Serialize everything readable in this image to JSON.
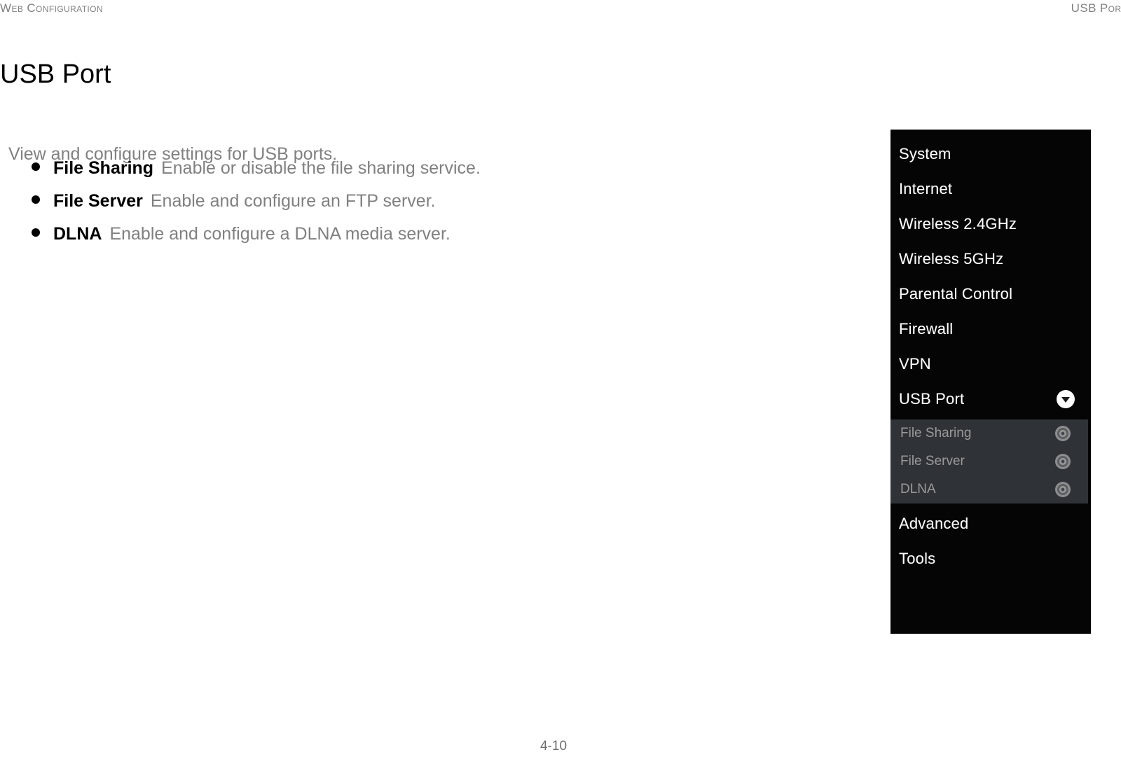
{
  "header": {
    "left": "Web Configuration",
    "right": "USB Port"
  },
  "title": "USB Port",
  "intro": "View and configure settings for USB ports.",
  "bullets": [
    {
      "term": "File Sharing",
      "desc": "Enable or disable the file sharing service."
    },
    {
      "term": "File Server",
      "desc": "Enable and configure an FTP server."
    },
    {
      "term": "DLNA",
      "desc": "Enable and configure a DLNA media server."
    }
  ],
  "menu": {
    "items": [
      {
        "label": "System"
      },
      {
        "label": "Internet"
      },
      {
        "label": "Wireless 2.4GHz"
      },
      {
        "label": "Wireless 5GHz"
      },
      {
        "label": "Parental Control"
      },
      {
        "label": "Firewall"
      },
      {
        "label": "VPN"
      },
      {
        "label": "USB Port",
        "icon": "chevron-down-circle-icon"
      },
      {
        "label": "Advanced"
      },
      {
        "label": "Tools"
      }
    ],
    "submenu": [
      {
        "label": "File Sharing",
        "icon": "ring-icon"
      },
      {
        "label": "File Server",
        "icon": "ring-icon"
      },
      {
        "label": "DLNA",
        "icon": "ring-icon"
      }
    ]
  },
  "footer": {
    "page": "4-10"
  },
  "colors": {
    "menu_background": "#050506",
    "submenu_background": "#2f3236",
    "menu_text": "#ffffff",
    "submenu_text": "#9a9a9a",
    "body_text": "#808080",
    "heading_text": "#000000"
  }
}
